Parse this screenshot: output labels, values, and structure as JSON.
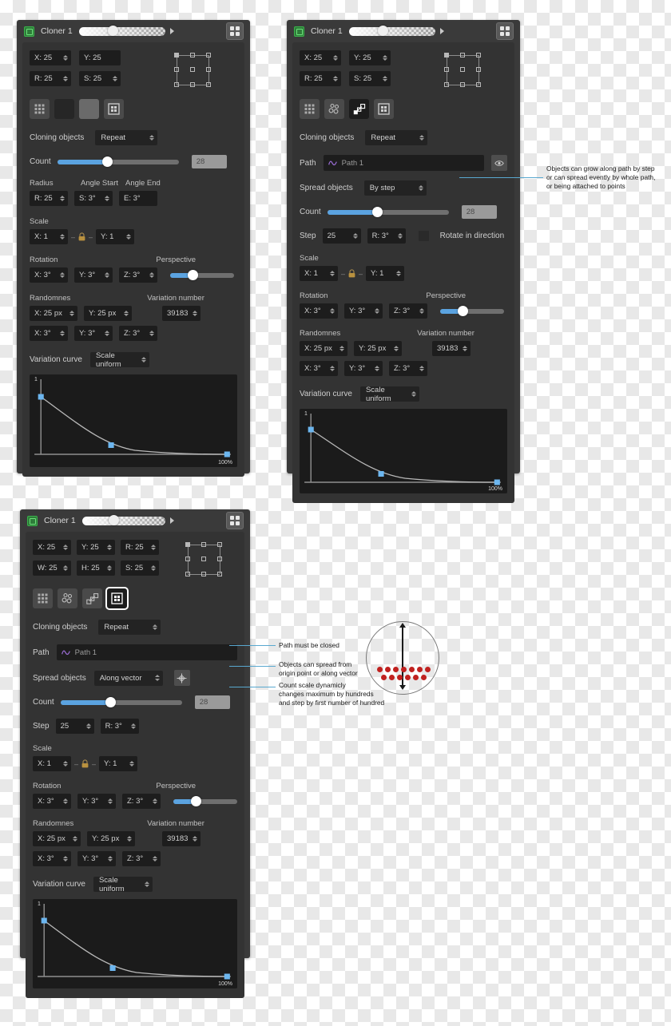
{
  "header": {
    "title": "Cloner 1",
    "app_icon": "cloner-icon",
    "grid_button_icon": "grid-2x2-icon",
    "opacity_slider_value": 28
  },
  "labels": {
    "cloning_objects": "Cloning objects",
    "path": "Path",
    "spread_objects": "Spread objects",
    "count": "Count",
    "step": "Step",
    "rotate_in_direction": "Rotate in direction",
    "radius": "Radius",
    "angle_start": "Angle Start",
    "angle_end": "Angle End",
    "scale": "Scale",
    "rotation": "Rotation",
    "perspective": "Perspective",
    "randomnes": "Randomnes",
    "variation_number": "Variation number",
    "variation_curve": "Variation curve"
  },
  "values": {
    "x": "X: 25",
    "y": "Y: 25",
    "r": "R: 25",
    "s": "S: 25",
    "w": "W: 25",
    "h": "H: 25",
    "radius_r": "R: 25",
    "angle_s": "S: 3°",
    "angle_e": "E: 3°",
    "scale_x": "X: 1",
    "scale_y": "Y: 1",
    "rot_x": "X: 3°",
    "rot_y": "Y: 3°",
    "rot_z": "Z: 3°",
    "rand_x_px": "X: 25 px",
    "rand_y_px": "Y: 25 px",
    "rand_x": "X: 3°",
    "rand_y": "Y: 3°",
    "rand_z": "Z: 3°",
    "variation_number": "39183",
    "count_number": "28",
    "step_value": "25",
    "step_r": "R: 3°",
    "path_name": "Path 1"
  },
  "dropdowns": {
    "cloning_objects": "Repeat",
    "spread_by_step": "By step",
    "spread_along_vector": "Along vector",
    "variation_curve": "Scale uniform"
  },
  "curve": {
    "y_max_label": "1",
    "x_max_label": "100%"
  },
  "chart_data": {
    "type": "line",
    "title": "Variation curve",
    "xlabel": "",
    "ylabel": "",
    "xlim": [
      0,
      100
    ],
    "ylim": [
      0,
      1
    ],
    "x_tick_labels": [
      "100%"
    ],
    "y_tick_labels": [
      "1"
    ],
    "grid": false,
    "legend": "none",
    "series": [
      {
        "name": "Scale uniform decay",
        "control_points": [
          [
            0,
            0.78
          ],
          [
            40,
            0.17
          ],
          [
            100,
            0.02
          ]
        ],
        "x": [
          0,
          5,
          10,
          15,
          20,
          25,
          30,
          35,
          40,
          50,
          60,
          70,
          80,
          90,
          100
        ],
        "y": [
          0.78,
          0.62,
          0.5,
          0.41,
          0.33,
          0.27,
          0.23,
          0.2,
          0.17,
          0.11,
          0.07,
          0.05,
          0.04,
          0.03,
          0.02
        ]
      }
    ]
  },
  "annotations": {
    "path_growth": "Objects  can grow along path by step\nor can spread evently by whole path,\nor being attached to points",
    "path_closed": "Path must be closed",
    "spread_origin": "Objects can spread from\norigin point or along vector",
    "count_scale": "Count scale dynamicly\nchanges maximum by hundreds\nand step by first number of hundred"
  },
  "icons": {
    "mode_grid": "grid-3x3-icon",
    "mode_radial": "radial-cluster-icon",
    "mode_path": "path-nodes-icon",
    "mode_object": "object-frame-icon",
    "eye": "eye-icon",
    "target": "target-crosshair-icon",
    "wave": "wave-path-icon"
  },
  "colors": {
    "accent_blue": "#5ba3e0",
    "connector": "#59a8cf",
    "dot_red": "#c0211f",
    "panel_bg": "#3a3a3a",
    "body_bg": "#333333",
    "field_bg": "#1d1d1d",
    "green": "#3ab24a",
    "purple": "#9b6dd6"
  }
}
